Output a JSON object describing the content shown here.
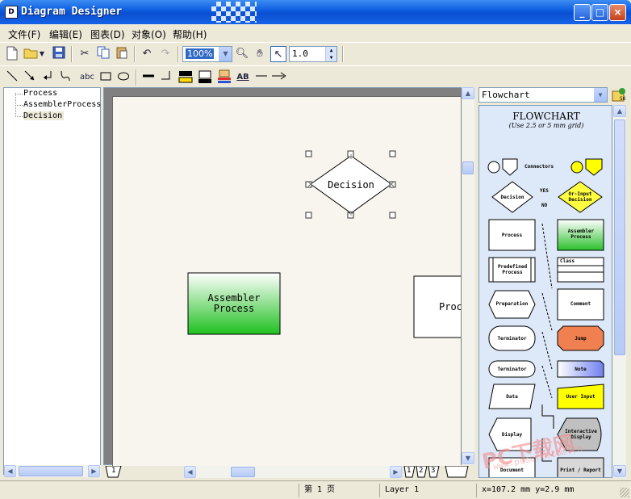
{
  "window": {
    "title": "Diagram Designer",
    "controls": {
      "minimize": "_",
      "maximize": "□",
      "close": "×"
    }
  },
  "menu": [
    "文件(F)",
    "编辑(E)",
    "图表(D)",
    "对象(O)",
    "帮助(H)"
  ],
  "toolbar": {
    "zoom_value": "100%",
    "line_width_value": "1.0",
    "icons": [
      "new-icon",
      "open-icon",
      "save-icon",
      "cut-icon",
      "copy-icon",
      "paste-icon",
      "undo-icon",
      "redo-icon",
      "zoom-icon",
      "hand-icon",
      "select-icon"
    ]
  },
  "drawing_toolbar": {
    "text_tool_label": "abc",
    "text_style_label": "AB",
    "icons": [
      "line-icon",
      "arrow-line-icon",
      "elbow-line-icon",
      "curve-line-icon",
      "text-icon",
      "rectangle-icon",
      "ellipse-icon",
      "line-thick-icon",
      "line-corner-icon",
      "fill-color-icon",
      "line-color-icon",
      "text-color-icon",
      "font-icon",
      "line-style-icon",
      "arrow-style-icon"
    ]
  },
  "tree": {
    "items": [
      "Process",
      "AssemblerProcess",
      "Decision"
    ]
  },
  "canvas": {
    "shapes": {
      "decision": "Decision",
      "assembler_line1": "Assembler",
      "assembler_line2": "Process",
      "process": "Proc"
    }
  },
  "page_tabs": {
    "left": "1",
    "right": [
      "1",
      "2",
      "3"
    ]
  },
  "stencil": {
    "selected": "Flowchart",
    "title": "FLOWCHART",
    "subtitle": "(Use 2.5 or 5 mm grid)",
    "labels": {
      "connectors": "Connectors",
      "decision": "Decision",
      "yes": "YES",
      "no": "NO",
      "or_input_decision": "Or-Input Decision",
      "process": "Process",
      "assembler_process": "Assembler Process",
      "predefined_process": "Predefined Process",
      "class": "Class",
      "preparation": "Preparation",
      "comment": "Comment",
      "terminator1": "Terminator",
      "jump": "Jump",
      "terminator2": "Terminator",
      "note": "Note",
      "data": "Data",
      "user_input": "User Input",
      "display": "Display",
      "interactive_display": "Interactive Display",
      "document": "Document",
      "print_report": "Print / Report"
    },
    "colors": {
      "assembler_fill": "#2bc02b",
      "jump_fill": "#f08050",
      "note_fill": "#8090f0",
      "user_input_fill": "#ffff00",
      "or_input_fill": "#ffff40"
    }
  },
  "status": {
    "page": "第 1 页",
    "layer": "Layer 1",
    "coords": "x=107.2 mm  y=2.9 mm"
  },
  "watermark": {
    "text": "PC下载网",
    "url": "www.pcsoft.com.cn"
  }
}
